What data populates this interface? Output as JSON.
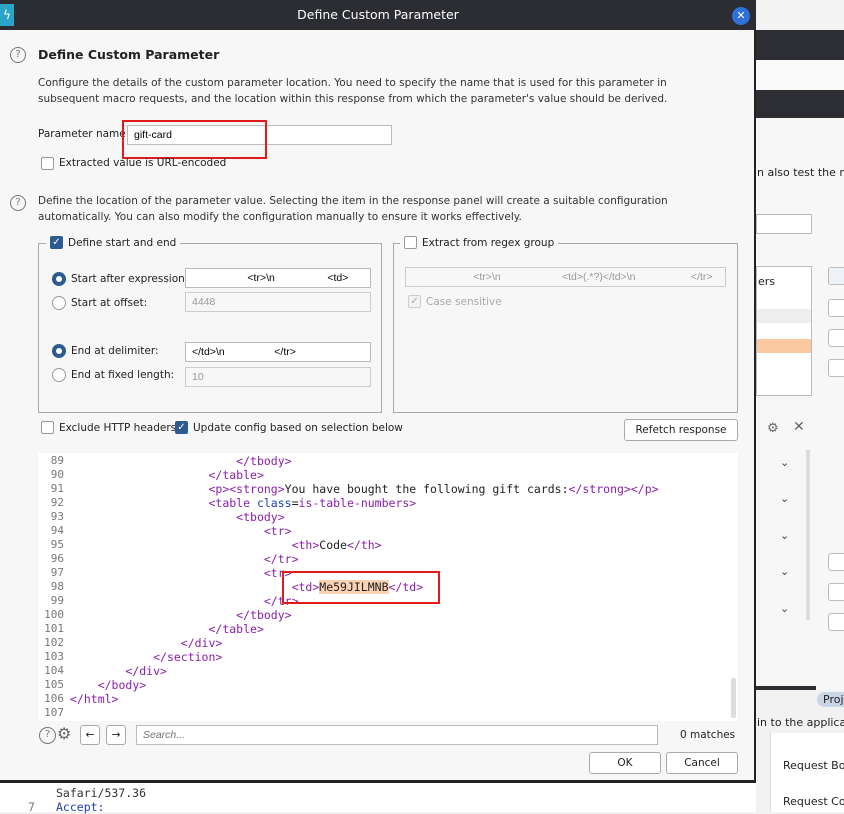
{
  "dialog": {
    "title": "Define Custom Parameter",
    "heading": "Define Custom Parameter",
    "intro": "Configure the details of the custom parameter location. You need to specify the name that is used for this parameter in subsequent macro requests, and the location within this response from which the parameter's value should be derived.",
    "param_name_label": "Parameter name",
    "param_name_value": "gift-card",
    "url_encoded_label": "Extracted value is URL-encoded",
    "url_encoded_checked": false,
    "location_help": "Define the location of the parameter value. Selecting the item in the response panel will create a suitable configuration automatically. You can also modify the configuration manually to ensure it works effectively.",
    "start_end": {
      "label": "Define start and end",
      "checked": true,
      "start_after_label": "Start after expression:",
      "start_after_value": "                   <tr>\\n                  <td>",
      "start_offset_label": "Start at offset:",
      "start_offset_value": "4448",
      "end_delim_label": "End at delimiter:",
      "end_delim_value": "</td>\\n                 </tr>",
      "end_fixed_label": "End at fixed length:",
      "end_fixed_value": "10"
    },
    "regex": {
      "label": "Extract from regex group",
      "checked": false,
      "value": "                     <tr>\\n                     <td>(.*?)</td>\\n                   </tr>",
      "case_label": "Case sensitive",
      "case_checked": true
    },
    "exclude_headers_label": "Exclude HTTP headers",
    "update_config_label": "Update config based on selection below",
    "refetch_label": "Refetch response",
    "search_placeholder": "Search...",
    "matches": "0 matches",
    "ok": "OK",
    "cancel": "Cancel"
  },
  "code_lines": [
    {
      "n": "89",
      "t": [
        [
          "                        ",
          ""
        ],
        [
          "</tbody>",
          "tag"
        ]
      ]
    },
    {
      "n": "90",
      "t": [
        [
          "                    ",
          ""
        ],
        [
          "</table>",
          "tag"
        ]
      ]
    },
    {
      "n": "91",
      "t": [
        [
          "                    ",
          ""
        ],
        [
          "<p><strong>",
          "tag"
        ],
        [
          "You have bought the following gift cards:",
          ""
        ],
        [
          "</strong></p>",
          "tag"
        ]
      ]
    },
    {
      "n": "92",
      "t": [
        [
          "                    ",
          ""
        ],
        [
          "<table ",
          "tag"
        ],
        [
          "class",
          "attr"
        ],
        [
          "=",
          ""
        ],
        [
          "is-table-numbers",
          "val"
        ],
        [
          ">",
          "tag"
        ]
      ]
    },
    {
      "n": "93",
      "t": [
        [
          "                        ",
          ""
        ],
        [
          "<tbody>",
          "tag"
        ]
      ]
    },
    {
      "n": "94",
      "t": [
        [
          "                            ",
          ""
        ],
        [
          "<tr>",
          "tag"
        ]
      ]
    },
    {
      "n": "95",
      "t": [
        [
          "                                ",
          ""
        ],
        [
          "<th>",
          "tag"
        ],
        [
          "Code",
          ""
        ],
        [
          "</th>",
          "tag"
        ]
      ]
    },
    {
      "n": "96",
      "t": [
        [
          "                            ",
          ""
        ],
        [
          "</tr>",
          "tag"
        ]
      ]
    },
    {
      "n": "97",
      "t": [
        [
          "                            ",
          ""
        ],
        [
          "<tr>",
          "tag"
        ]
      ]
    },
    {
      "n": "98",
      "t": [
        [
          "                                ",
          ""
        ],
        [
          "<td>",
          "tag"
        ],
        [
          "Me59JILMNB",
          "hl"
        ],
        [
          "</td>",
          "tag"
        ]
      ]
    },
    {
      "n": "99",
      "t": [
        [
          "                            ",
          ""
        ],
        [
          "</tr>",
          "tag"
        ]
      ]
    },
    {
      "n": "100",
      "t": [
        [
          "                        ",
          ""
        ],
        [
          "</tbody>",
          "tag"
        ]
      ]
    },
    {
      "n": "101",
      "t": [
        [
          "                    ",
          ""
        ],
        [
          "</table>",
          "tag"
        ]
      ]
    },
    {
      "n": "102",
      "t": [
        [
          "                ",
          ""
        ],
        [
          "</div>",
          "tag"
        ]
      ]
    },
    {
      "n": "103",
      "t": [
        [
          "            ",
          ""
        ],
        [
          "</section>",
          "tag"
        ]
      ]
    },
    {
      "n": "104",
      "t": [
        [
          "        ",
          ""
        ],
        [
          "</div>",
          "tag"
        ]
      ]
    },
    {
      "n": "105",
      "t": [
        [
          "    ",
          ""
        ],
        [
          "</body>",
          "tag"
        ]
      ]
    },
    {
      "n": "106",
      "t": [
        [
          "</html>",
          "tag"
        ]
      ]
    },
    {
      "n": "107",
      "t": []
    }
  ],
  "background": {
    "macro_text": "n also test the mac",
    "list_item": "ers",
    "tab": "Proje",
    "status": "in to the applicatio",
    "req_body": "Request Bod",
    "req_cookies": "Request Coo",
    "code_line_prev": "Safari/537.36",
    "code_line_num": "7",
    "code_line": "Accept:"
  },
  "colors": {
    "accent": "#2c5c8f",
    "highlight": "#fbd3b4",
    "annotation": "#e01b1b",
    "titlebar": "#2b2d32"
  }
}
